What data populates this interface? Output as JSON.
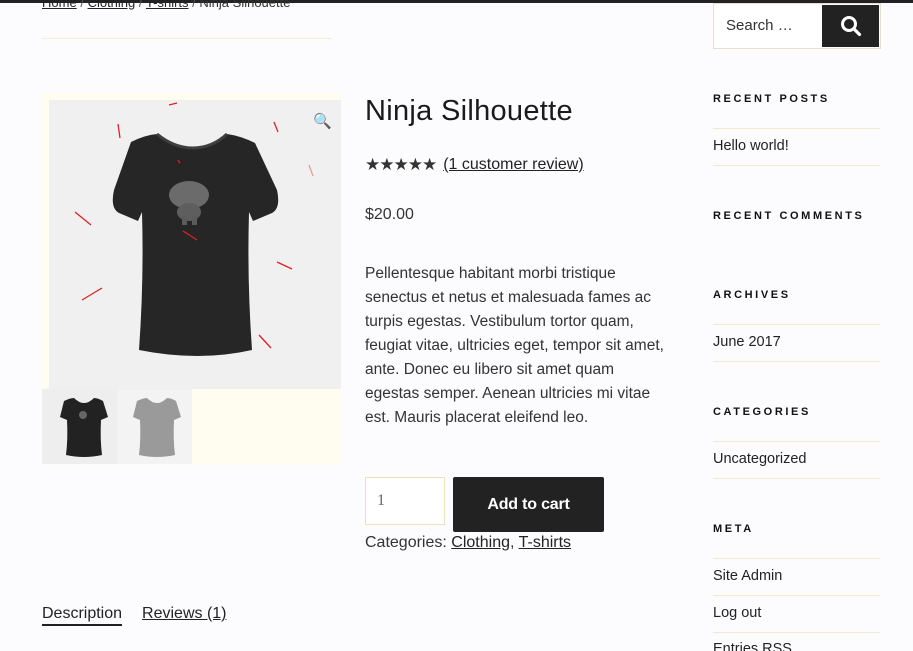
{
  "breadcrumb": {
    "home": "Home",
    "clothing": "Clothing",
    "tshirts": "T-shirts",
    "sep": "/",
    "current": "Ninja Silhouette"
  },
  "product": {
    "title": "Ninja Silhouette",
    "rating": {
      "stars": "★★★★★",
      "value_out_of_5": 5
    },
    "review_link": "(1 customer review)",
    "price": "$20.00",
    "description": "Pellentesque habitant morbi tristique senectus et netus et malesuada fames ac turpis egestas. Vestibulum tortor quam, feugiat vitae, ultricies eget, tempor sit amet, ante. Donec eu libero sit amet quam egestas semper. Aenean ultricies mi vitae est. Mauris placerat eleifend leo.",
    "quantity": "1",
    "add_to_cart": "Add to cart",
    "categories_label": "Categories:",
    "categories": [
      "Clothing",
      "T-shirts"
    ],
    "categories_sep": ","
  },
  "gallery": {
    "zoom_icon": "magnifier-icon",
    "zoom_glyph": "🔍",
    "thumbnails": [
      "black-tshirt",
      "grey-tshirt"
    ]
  },
  "tabs": [
    "Description",
    "Reviews (1)"
  ],
  "sidebar": {
    "search_placeholder": "Search …",
    "search_icon": "search-icon",
    "recent_posts": {
      "title": "RECENT POSTS",
      "items": [
        "Hello world!"
      ]
    },
    "recent_comments": {
      "title": "RECENT COMMENTS"
    },
    "archives": {
      "title": "ARCHIVES",
      "items": [
        "June 2017"
      ]
    },
    "categories": {
      "title": "CATEGORIES",
      "items": [
        "Uncategorized"
      ]
    },
    "meta": {
      "title": "META",
      "items": [
        "Site Admin",
        "Log out",
        "Entries RSS"
      ]
    }
  },
  "colors": {
    "dark": "#222222",
    "background": "#fcfcfe",
    "text": "#333333"
  }
}
